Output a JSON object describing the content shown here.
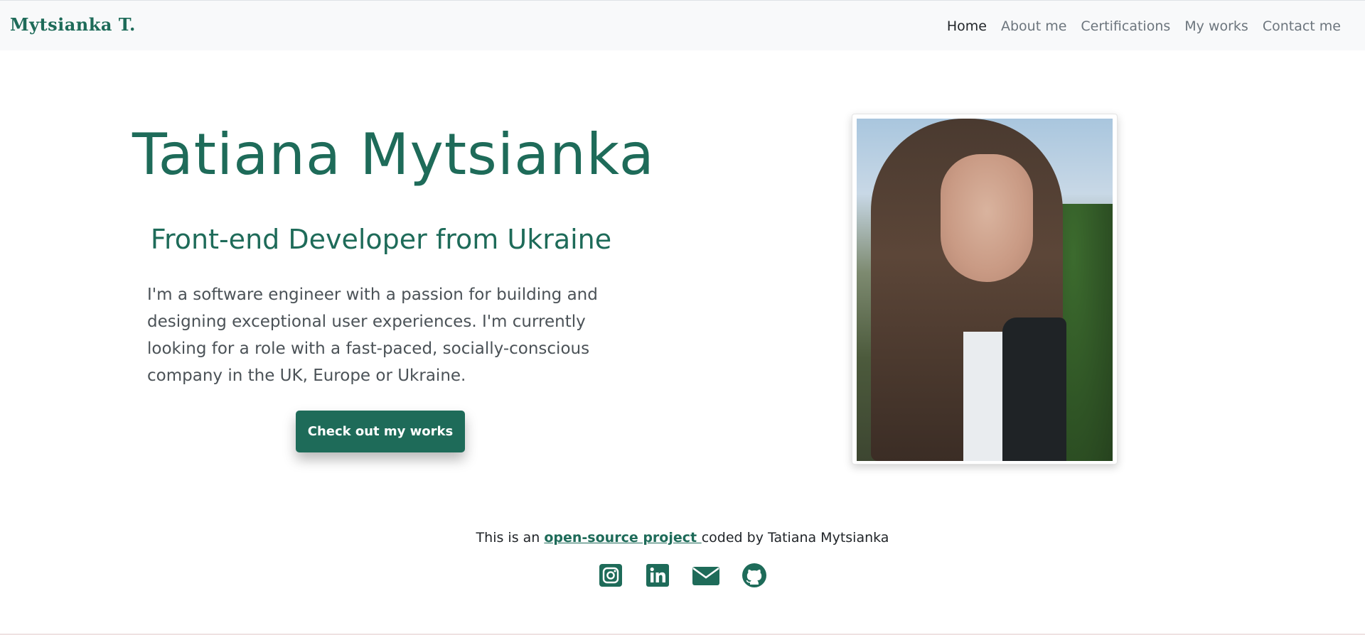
{
  "navbar": {
    "brand": "Mytsianka T.",
    "links": [
      "Home",
      "About me",
      "Certifications",
      "My works",
      "Contact me"
    ],
    "active": "Home"
  },
  "hero": {
    "name": "Tatiana Mytsianka",
    "subtitle": "Front-end Developer from Ukraine",
    "description": "I'm a software engineer with a passion for building and designing exceptional user experiences. I'm currently looking for a role with a fast-paced, socially-conscious company in the UK, Europe or Ukraine.",
    "cta_label": "Check out my works"
  },
  "footer": {
    "prefix": "This is an ",
    "link_label": "open-source project ",
    "suffix": "coded by Tatiana Mytsianka",
    "social_icons": [
      "instagram-icon",
      "linkedin-icon",
      "email-icon",
      "github-icon"
    ]
  },
  "colors": {
    "accent": "#1e6b59",
    "navbar_bg": "#f8f9fa",
    "text_muted": "#6c757d"
  }
}
